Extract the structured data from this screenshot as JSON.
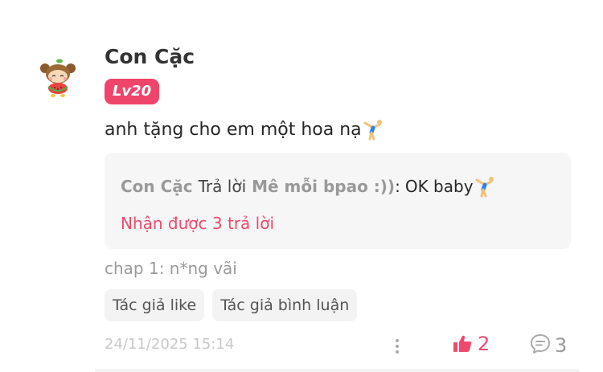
{
  "user": {
    "name": "Con Cặc",
    "level": "Lv20"
  },
  "comment": {
    "text": "anh tặng cho em một hoa nạ"
  },
  "reply_preview": {
    "author": "Con Cặc",
    "verb": "Trả lời",
    "target": "Mê mỗi bpao :))",
    "separator": ":",
    "text": "OK baby",
    "replies_label": "Nhận được 3 trả lời"
  },
  "chapter": "chap 1: n*ng vãi",
  "tags": [
    "Tác giả like",
    "Tác giả bình luận"
  ],
  "timestamp": "24/11/2025 15:14",
  "actions": {
    "like_count": "2",
    "comment_count": "3"
  },
  "colors": {
    "accent": "#f0456a",
    "muted": "#999999"
  },
  "icons": {
    "avatar": "cartoon-avatar",
    "emoji": "gymnast-emoji",
    "more": "vertical-ellipsis-icon",
    "like": "thumbs-up-icon",
    "comment": "speech-bubble-icon"
  }
}
